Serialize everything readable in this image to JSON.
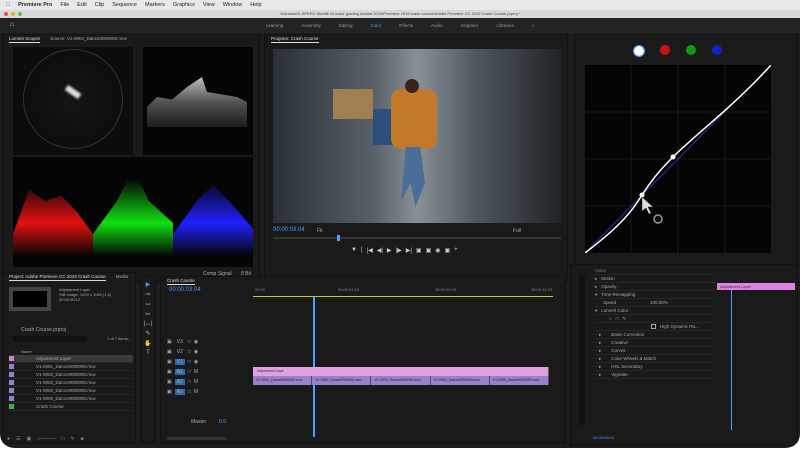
{
  "menubar": {
    "app": "Premiere Pro",
    "items": [
      "File",
      "Edit",
      "Clip",
      "Sequence",
      "Markers",
      "Graphics",
      "View",
      "Window",
      "Help"
    ]
  },
  "titlebar": {
    "path": "/Volumes/G-SPEED Shuttle XL/color grading tutorial 2019/Premiere 2019 crash course/Adobe Premiere CC 2019 Crash Course.prproj *"
  },
  "workspaces": {
    "items": [
      "Learning",
      "Assembly",
      "Editing",
      "Color",
      "Effects",
      "Audio",
      "Graphics",
      "Libraries"
    ],
    "active": "Color"
  },
  "scopes": {
    "tabs": [
      "Lumetri Scopes",
      "Source: V1-0004_Dance0000000.mov"
    ]
  },
  "program": {
    "tab": "Program: Crash Course",
    "timecode": "00:00:03:04",
    "fit": "Fit",
    "quality": "Full"
  },
  "curves": {
    "channels": [
      {
        "name": "luma",
        "color": "#ffffff"
      },
      {
        "name": "red",
        "color": "#cc1111"
      },
      {
        "name": "green",
        "color": "#119911"
      },
      {
        "name": "blue",
        "color": "#1122cc"
      }
    ]
  },
  "project": {
    "tabs": [
      "Project: Adobe Premiere CC 2019 Crash Course",
      "Media"
    ],
    "preview": {
      "name": "Adjustment Layer",
      "info": "Still Image, 1920 x 1080 (1.0)",
      "duration": "00:00:05:12"
    },
    "bin": "Crash Course.prproj",
    "count": "1 of 7 items...",
    "column": "Name",
    "items": [
      {
        "name": "Adjustment Layer",
        "color": "#d080d0"
      },
      {
        "name": "V1-0001_Dance0000000.mov",
        "color": "#9a80d0"
      },
      {
        "name": "V1-0002_Dance0000000.mov",
        "color": "#9a80d0"
      },
      {
        "name": "V1-0003_Dance0000000.mov",
        "color": "#9a80d0"
      },
      {
        "name": "V1-0004_Dance0000000.mov",
        "color": "#9a80d0"
      },
      {
        "name": "V1-0005_Dance0000000.mov",
        "color": "#9a80d0"
      },
      {
        "name": "Crash Course",
        "color": "#40b040"
      }
    ]
  },
  "timeline": {
    "tab": "Crash Course",
    "timecode": "00:00:03:04",
    "ruler": [
      "00:00",
      "00:00:04:23",
      "00:00:09:23",
      "00:00:14:23"
    ],
    "adjustment_clip": "Adjustment Layer",
    "clips": [
      "V1-0001_Dance0000000.mov",
      "V1-0002_Dance0000000.mov",
      "V1-0003_Dance0000000.mov",
      "V1-0004_Dance0000000.mov",
      "V1-0005_Dance0000000.mov"
    ],
    "master": "Master",
    "master_val": "0.0",
    "tracks": [
      "V3",
      "V2",
      "V1",
      "A1",
      "A2",
      "A3"
    ]
  },
  "monitor_extra": {
    "comp_label": "Comp Signal",
    "bits": "8 Bit"
  },
  "effects": {
    "header": "Video",
    "items": [
      "Motion",
      "Opacity",
      "Time Remapping",
      "Speed",
      "Lumetri Color"
    ],
    "speed_value": "100.00%",
    "hdr": "High Dynamic Ra...",
    "sections": [
      "Basic Correction",
      "Creative",
      "Curves",
      "Color Wheels & Match",
      "HSL Secondary",
      "Vignette"
    ],
    "timecode": "00:00:03:04",
    "clip": "Adjustment Layer"
  }
}
